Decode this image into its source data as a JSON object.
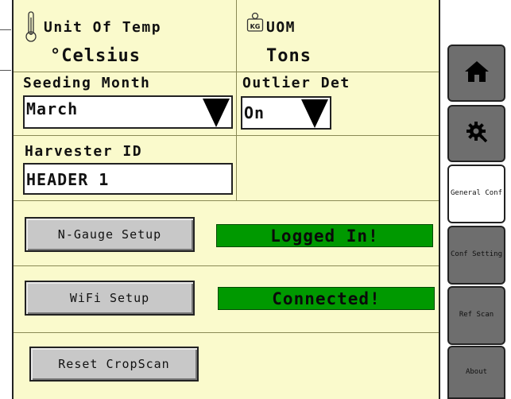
{
  "temp": {
    "label": "Unit Of Temp",
    "value": "°Celsius",
    "icon": "thermometer-icon"
  },
  "uom": {
    "label": "UOM",
    "value": "Tons",
    "icon": "weight-icon",
    "icon_text": "KG"
  },
  "seeding_month": {
    "label": "Seeding Month",
    "value": "March"
  },
  "outlier_det": {
    "label": "Outlier Det",
    "value": "On"
  },
  "harvester": {
    "label": "Harvester ID",
    "value": "HEADER 1"
  },
  "ngauge": {
    "button": "N-Gauge Setup",
    "status": "Logged In!"
  },
  "wifi": {
    "button": "WiFi Setup",
    "status": "Connected!"
  },
  "reset": {
    "button": "Reset CropScan"
  },
  "sidebar": {
    "home_icon": "home-icon",
    "settings_icon": "gear-wrench-icon",
    "general_conf": "General Conf",
    "conf_setting": "Conf Setting",
    "ref_scan": "Ref Scan",
    "about": "About"
  },
  "colors": {
    "panel": "#fafacc",
    "status_green": "#009900",
    "button_gray": "#c8c8c8",
    "tab_gray": "#6e6e6e",
    "tab_active": "#ffffff"
  }
}
